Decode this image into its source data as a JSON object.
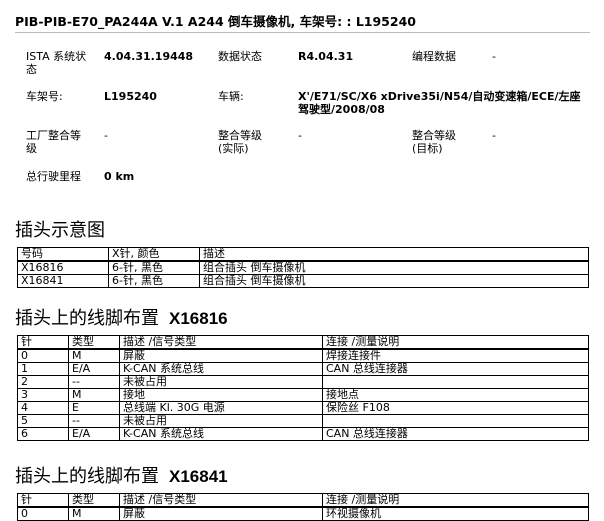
{
  "header": {
    "title": "PIB-PIB-E70_PA244A   V.1   A244 倒车摄像机, 车架号: : L195240"
  },
  "info": {
    "ista_label": "ISTA 系统状态",
    "ista_value": "4.04.31.19448",
    "data_status_label": "数据状态",
    "data_status_value": "R4.04.31",
    "programming_label": "编程数据",
    "programming_value": "-",
    "vin_label": "车架号:",
    "vin_value": "L195240",
    "vehicle_label": "车辆:",
    "vehicle_value": "X'/E71/SC/X6 xDrive35i/N54/自动变速箱/ECE/左座驾驶型/2008/08",
    "factory_label": "工厂整合等级",
    "factory_value": "-",
    "actual_label": "整合等级\n(实际)",
    "actual_value": "-",
    "target_label": "整合等级\n(目标)",
    "target_value": "-",
    "mileage_label": "总行驶里程",
    "mileage_value": "0 km"
  },
  "connector_diagram": {
    "heading": "插头示意图",
    "columns": [
      "号码",
      "X针, 颜色",
      "描述"
    ],
    "rows": [
      [
        "X16816",
        "6-针, 黑色",
        "组合插头  倒车摄像机"
      ],
      [
        "X16841",
        "6-针, 黑色",
        "组合插头  倒车摄像机"
      ]
    ]
  },
  "pinout_1": {
    "heading": "插头上的线脚布置",
    "connector": "X16816",
    "columns": [
      "针",
      "类型",
      "描述 /信号类型",
      "连接 /测量说明"
    ],
    "rows": [
      [
        "0",
        "M",
        "屏蔽",
        "焊接连接件"
      ],
      [
        "1",
        "E/A",
        "K-CAN 系统总线",
        "CAN 总线连接器"
      ],
      [
        "2",
        "--",
        "未被占用",
        ""
      ],
      [
        "3",
        "M",
        "接地",
        "接地点"
      ],
      [
        "4",
        "E",
        "总线端  Kl. 30G 电源",
        "保险丝  F108"
      ],
      [
        "5",
        "--",
        "未被占用",
        ""
      ],
      [
        "6",
        "E/A",
        "K-CAN 系统总线",
        "CAN 总线连接器"
      ]
    ]
  },
  "pinout_2": {
    "heading": "插头上的线脚布置",
    "connector": "X16841",
    "columns": [
      "针",
      "类型",
      "描述 /信号类型",
      "连接 /测量说明"
    ],
    "rows": [
      [
        "0",
        "M",
        "屏蔽",
        "环视摄像机"
      ]
    ]
  }
}
